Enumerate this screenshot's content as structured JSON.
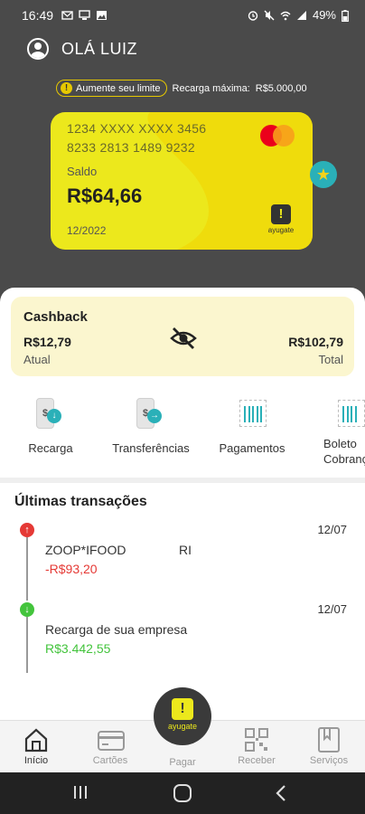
{
  "status_bar": {
    "time": "16:49",
    "battery": "49%",
    "icons": [
      "notification-icon",
      "mail-icon",
      "screen-icon",
      "image-icon",
      "alarm-icon",
      "mute-icon",
      "wifi-icon",
      "signal-icon",
      "battery-icon"
    ]
  },
  "header": {
    "greeting": "OLÁ LUIZ"
  },
  "limit": {
    "pill_label": "Aumente seu limite",
    "recharge_label": "Recarga máxima:",
    "recharge_value": "R$5.000,00"
  },
  "card": {
    "number_line1": "1234 XXXX XXXX 3456",
    "number_line2": "8233 2813 1489 9232",
    "balance_label": "Saldo",
    "balance_value": "R$64,66",
    "expiry": "12/2022",
    "brand": "ayugate",
    "color": "#ece81c"
  },
  "cashback": {
    "title": "Cashback",
    "current_value": "R$12,79",
    "current_label": "Atual",
    "total_value": "R$102,79",
    "total_label": "Total"
  },
  "actions": [
    {
      "label": "Recarga",
      "icon": "phone-download-icon"
    },
    {
      "label": "Transferências",
      "icon": "phone-transfer-icon"
    },
    {
      "label": "Pagamentos",
      "icon": "barcode-icon"
    },
    {
      "label": "Boleto\nCobrança",
      "icon": "barcode-invoice-icon"
    }
  ],
  "transactions": {
    "title": "Últimas transações",
    "items": [
      {
        "name": "ZOOP*IFOOD",
        "location": "RI",
        "amount": "-R$93,20",
        "date": "12/07",
        "direction": "out",
        "color": "#e53935"
      },
      {
        "name": "Recarga de sua empresa",
        "location": "",
        "amount": "R$3.442,55",
        "date": "12/07",
        "direction": "in",
        "color": "#43c43c"
      }
    ]
  },
  "bottom_nav": {
    "items": [
      {
        "label": "Início",
        "active": true
      },
      {
        "label": "Cartões",
        "active": false
      },
      {
        "label": "Pagar",
        "active": false
      },
      {
        "label": "Receber",
        "active": false
      },
      {
        "label": "Serviços",
        "active": false
      }
    ],
    "fab_brand": "ayugate"
  },
  "colors": {
    "dark_bg": "#4a4a4a",
    "accent_yellow": "#ece81c",
    "accent_teal": "#2ab0b8",
    "negative": "#e53935",
    "positive": "#43c43c"
  }
}
